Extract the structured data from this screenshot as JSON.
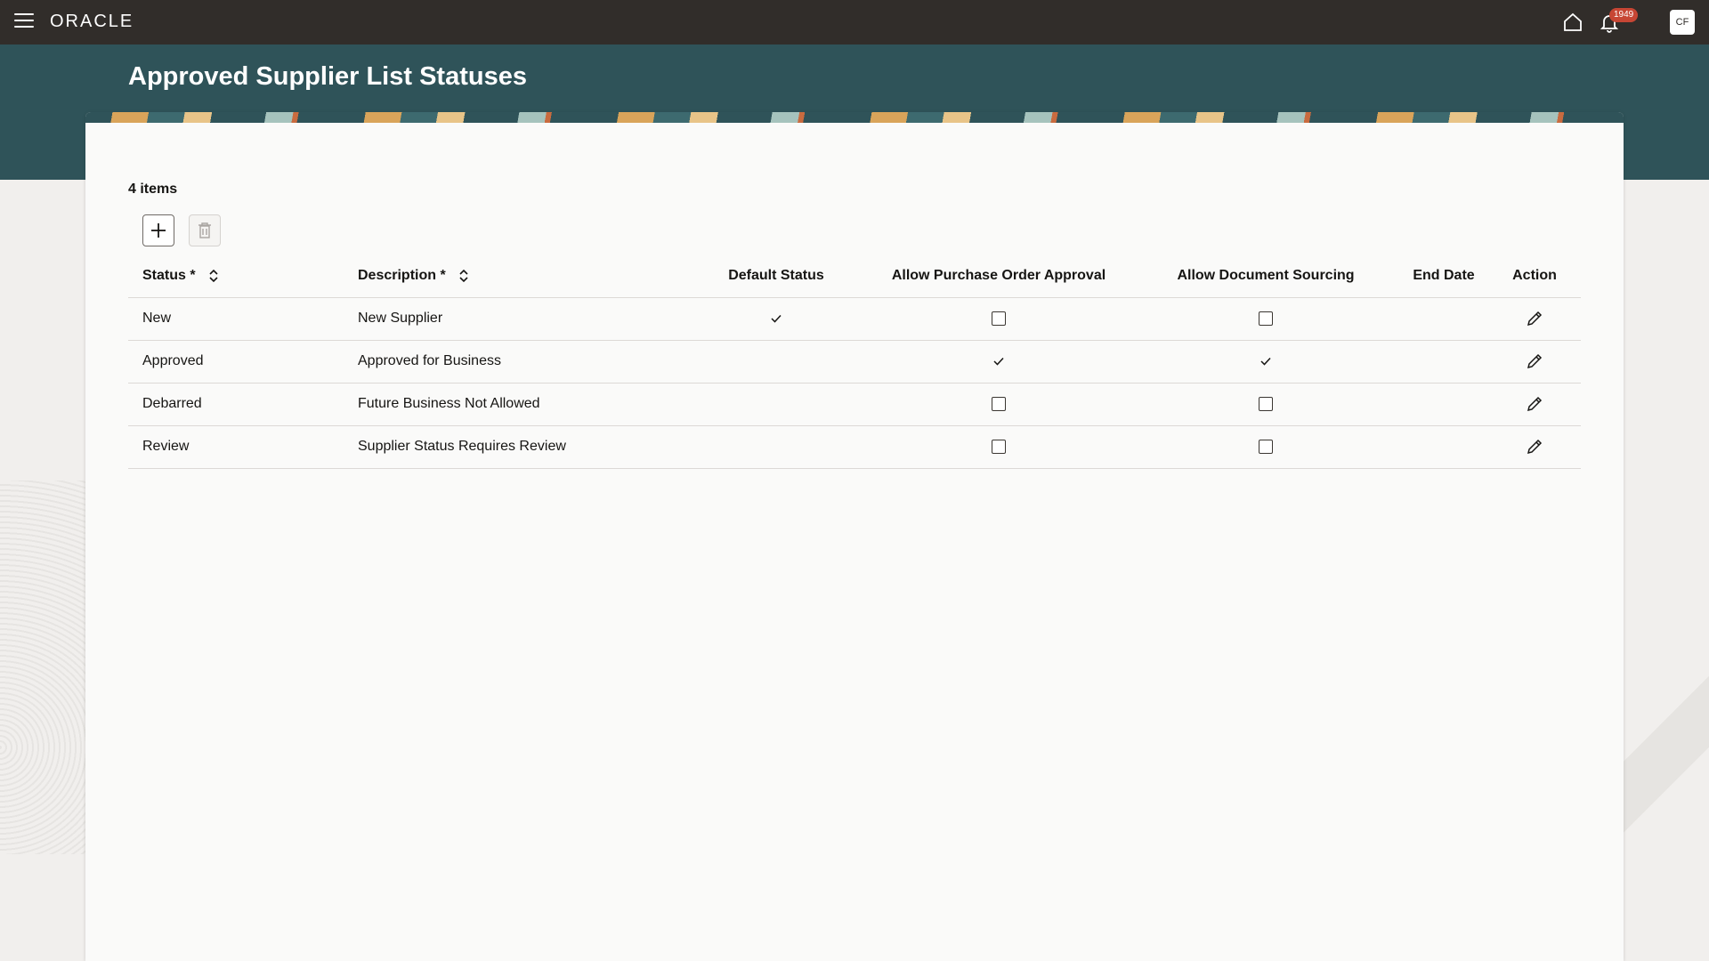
{
  "topbar": {
    "logo": "ORACLE",
    "notification_count": "1949",
    "avatar_initials": "CF"
  },
  "page": {
    "title": "Approved Supplier List Statuses"
  },
  "table": {
    "items_count": "4 items",
    "columns": {
      "status": "Status *",
      "description": "Description *",
      "default_status": "Default Status",
      "allow_po_approval": "Allow Purchase Order Approval",
      "allow_doc_sourcing": "Allow Document Sourcing",
      "end_date": "End Date",
      "action": "Action"
    },
    "rows": [
      {
        "status": "New",
        "description": "New Supplier",
        "default_status": true,
        "allow_po_approval": false,
        "allow_doc_sourcing": false,
        "end_date": ""
      },
      {
        "status": "Approved",
        "description": "Approved for Business",
        "default_status": false,
        "allow_po_approval": true,
        "allow_doc_sourcing": true,
        "end_date": ""
      },
      {
        "status": "Debarred",
        "description": "Future Business Not Allowed",
        "default_status": false,
        "allow_po_approval": false,
        "allow_doc_sourcing": false,
        "end_date": ""
      },
      {
        "status": "Review",
        "description": "Supplier Status Requires Review",
        "default_status": false,
        "allow_po_approval": false,
        "allow_doc_sourcing": false,
        "end_date": ""
      }
    ]
  },
  "icons": {
    "menu": "hamburger-menu-icon",
    "home": "home-icon",
    "notifications": "bell-icon",
    "add": "plus-icon",
    "delete": "trash-icon",
    "sort": "sort-icon",
    "edit": "pencil-icon",
    "checked": "checkmark-icon",
    "unchecked": "checkbox-icon"
  },
  "colors": {
    "topbar": "#312d2a",
    "hero": "#2f5359",
    "badge": "#c74634",
    "card": "#fafaf9"
  }
}
